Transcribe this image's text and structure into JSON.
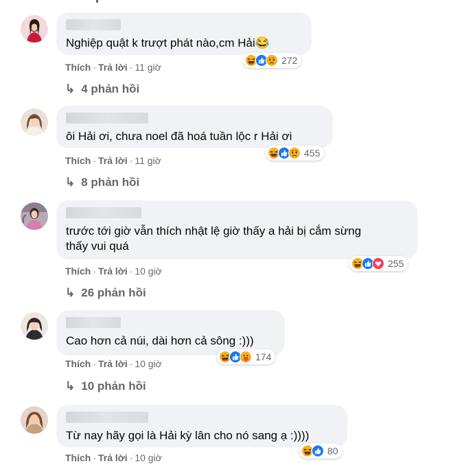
{
  "comments": [
    {
      "text": "Nghiệp quật k trượt phát nào,cm Hải😂",
      "like_label": "Thích",
      "reply_label": "Trả lời",
      "time": "11 giờ",
      "reaction_icons": [
        "haha-icon",
        "like-icon",
        "sad-icon"
      ],
      "reaction_count": "272",
      "replies_label": "4 phản hồi"
    },
    {
      "text": "ôi Hải ơi, chưa noel đã hoá tuần lộc r Hải ơi",
      "like_label": "Thích",
      "reply_label": "Trả lời",
      "time": "11 giờ",
      "reaction_icons": [
        "haha-icon",
        "like-icon",
        "sad-icon"
      ],
      "reaction_count": "455",
      "replies_label": "8 phản hồi"
    },
    {
      "text": "trước tới giờ vẫn thích nhật lệ giờ thấy a hải bị cắm sừng\nthấy vui quá",
      "like_label": "Thích",
      "reply_label": "Trả lời",
      "time": "10 giờ",
      "reaction_icons": [
        "haha-icon",
        "like-icon",
        "love-icon"
      ],
      "reaction_count": "255",
      "replies_label": "26 phản hồi"
    },
    {
      "text": "Cao hơn cả núi, dài hơn cả sông :)))",
      "like_label": "Thích",
      "reply_label": "Trả lời",
      "time": "10 giờ",
      "reaction_icons": [
        "haha-icon",
        "like-icon",
        "care-icon"
      ],
      "reaction_count": "174",
      "replies_label": "10 phản hồi"
    },
    {
      "text": "Từ nay hãy gọi là Hải kỳ lân cho nó sang ạ :))))",
      "like_label": "Thích",
      "reply_label": "Trả lời",
      "time": "10 giờ",
      "reaction_icons": [
        "haha-icon",
        "like-icon"
      ],
      "reaction_count": "80",
      "replies_label": ""
    }
  ],
  "colors": {
    "bubble": "#f0f2f5",
    "meta_text": "#65676b",
    "like_blue": "#1877f2",
    "haha_yellow": "#f7b125",
    "love_red": "#f33e58"
  }
}
